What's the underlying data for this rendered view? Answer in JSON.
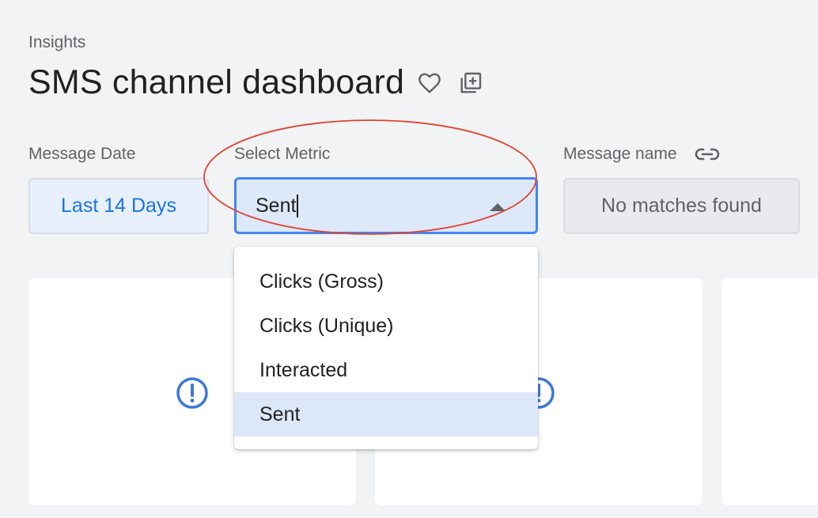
{
  "breadcrumb": "Insights",
  "title": "SMS channel dashboard",
  "icons": {
    "favorite": "heart-outline-icon",
    "copy": "library-add-icon",
    "link": "link-icon",
    "warning": "exclamation-circle-icon"
  },
  "filters": {
    "date": {
      "label": "Message Date",
      "value": "Last 14 Days"
    },
    "metric": {
      "label": "Select Metric",
      "value": "Sent"
    },
    "message_name": {
      "label": "Message name",
      "value": "No matches found"
    }
  },
  "dropdown": {
    "options": [
      "Clicks (Gross)",
      "Clicks (Unique)",
      "Interacted",
      "Sent"
    ],
    "selected": "Sent"
  },
  "colors": {
    "accent": "#1a73e8",
    "focus_border": "#4285f4",
    "selected_bg": "#dce7f7",
    "annotation": "#e0432f",
    "warning": "#3c78d8"
  }
}
